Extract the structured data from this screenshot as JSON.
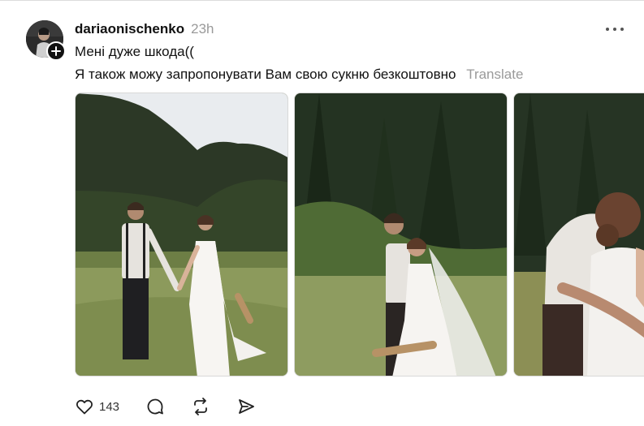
{
  "post": {
    "username": "dariaonischenko",
    "timestamp": "23h",
    "text_lines": [
      "Мені дуже шкода((",
      "Я також можу запропонувати Вам свою сукню безкоштовно"
    ],
    "translate_label": "Translate",
    "like_count": "143"
  },
  "icons": {
    "more": "more-horizontal-icon",
    "follow": "plus-icon",
    "like": "heart-icon",
    "comment": "comment-icon",
    "repost": "repost-icon",
    "share": "send-icon"
  },
  "colors": {
    "text": "#111111",
    "muted": "#9a9a9a",
    "border": "#dcdcdc"
  }
}
